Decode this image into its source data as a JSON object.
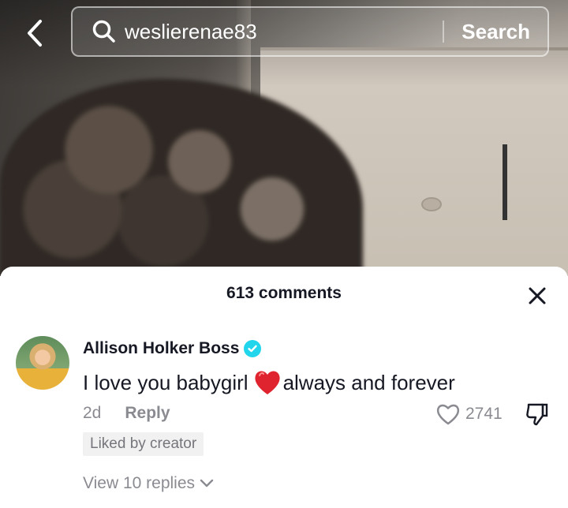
{
  "search": {
    "value": "weslierenae83",
    "button_label": "Search"
  },
  "comments": {
    "count_label": "613 comments",
    "items": [
      {
        "author": "Allison Holker Boss",
        "text_before": "I love you babygirl",
        "text_after": "always and forever",
        "age": "2d",
        "reply_label": "Reply",
        "likes": "2741",
        "badge": "Liked by creator",
        "view_replies": "View 10 replies"
      }
    ]
  },
  "icons": {
    "back": "chevron-left-icon",
    "search": "search-icon",
    "close": "close-icon",
    "verified": "verified-badge-icon",
    "heart_emoji": "red-heart-emoji",
    "like": "heart-outline-icon",
    "dislike": "thumbs-down-icon",
    "expand": "chevron-down-icon"
  },
  "colors": {
    "verified": "#20d5ec",
    "text_primary": "#161823",
    "text_secondary": "#8a8b91"
  }
}
